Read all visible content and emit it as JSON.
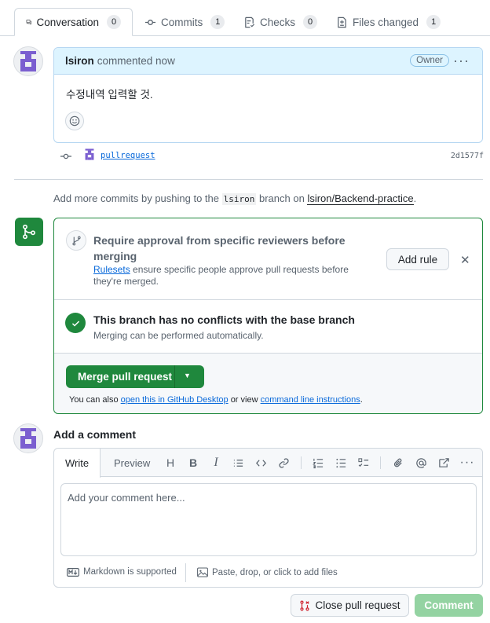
{
  "tabs": [
    {
      "label": "Conversation",
      "count": "0",
      "icon": "comment-discussion-icon"
    },
    {
      "label": "Commits",
      "count": "1",
      "icon": "git-commit-icon"
    },
    {
      "label": "Checks",
      "count": "0",
      "icon": "checklist-icon"
    },
    {
      "label": "Files changed",
      "count": "1",
      "icon": "file-diff-icon"
    }
  ],
  "comment": {
    "author": "lsiron",
    "meta": "commented now",
    "role_badge": "Owner",
    "body": "수정내역 입력할 것."
  },
  "commit": {
    "message": "pullrequest",
    "sha": "2d1577f"
  },
  "push_note": {
    "prefix": "Add more commits by pushing to the",
    "branch": "lsiron",
    "middle": "branch on",
    "repo": "lsiron/Backend-practice",
    "suffix": "."
  },
  "merge": {
    "ruleset_title": "Require approval from specific reviewers before merging",
    "ruleset_link": "Rulesets",
    "ruleset_desc": "ensure specific people approve pull requests before they're merged.",
    "add_rule_label": "Add rule",
    "conflict_title": "This branch has no conflicts with the base branch",
    "conflict_desc": "Merging can be performed automatically.",
    "merge_button": "Merge pull request",
    "also_prefix": "You can also",
    "also_link1": "open this in GitHub Desktop",
    "also_middle": "or view",
    "also_link2": "command line instructions",
    "also_suffix": ".",
    "accent_color": "#1f883d"
  },
  "add_comment": {
    "title": "Add a comment",
    "tab_write": "Write",
    "tab_preview": "Preview",
    "placeholder": "Add your comment here...",
    "markdown_note": "Markdown is supported",
    "attach_note": "Paste, drop, or click to add files"
  },
  "actions": {
    "close_pr": "Close pull request",
    "comment": "Comment"
  }
}
